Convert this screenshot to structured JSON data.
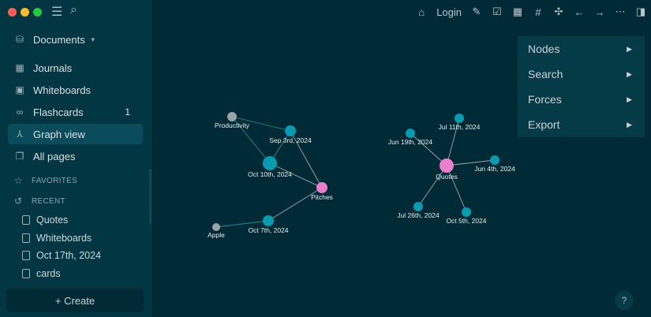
{
  "sidebar": {
    "workspace": "Documents",
    "nav": [
      {
        "label": "Journals",
        "icon": "calendar-icon"
      },
      {
        "label": "Whiteboards",
        "icon": "whiteboard-icon"
      },
      {
        "label": "Flashcards",
        "icon": "infinity-icon",
        "badge": "1"
      },
      {
        "label": "Graph view",
        "icon": "graph-icon",
        "active": true
      },
      {
        "label": "All pages",
        "icon": "pages-icon"
      }
    ],
    "favorites": "FAVORITES",
    "recent": "RECENT",
    "recent_items": [
      "Quotes",
      "Whiteboards",
      "Oct 17th, 2024",
      "cards"
    ],
    "create": "+ Create"
  },
  "toolbar": {
    "login": "Login"
  },
  "menu": [
    "Nodes",
    "Search",
    "Forces",
    "Export"
  ],
  "help": "?",
  "graph": {
    "nodes": [
      "Productivity",
      "Sep 3rd, 2024",
      "Oct 10th, 2024",
      "Pitches",
      "Oct 7th, 2024",
      "Apple",
      "Quotes",
      "Jun 19th, 2024",
      "Jul 11th, 2024",
      "Jun 4th, 2024",
      "Jul 26th, 2024",
      "Oct 5th, 2024"
    ],
    "edges": [
      [
        "Productivity",
        "Sep 3rd, 2024"
      ],
      [
        "Productivity",
        "Oct 10th, 2024"
      ],
      [
        "Sep 3rd, 2024",
        "Oct 10th, 2024"
      ],
      [
        "Sep 3rd, 2024",
        "Pitches"
      ],
      [
        "Oct 10th, 2024",
        "Pitches"
      ],
      [
        "Pitches",
        "Oct 7th, 2024"
      ],
      [
        "Oct 7th, 2024",
        "Apple"
      ],
      [
        "Quotes",
        "Jun 19th, 2024"
      ],
      [
        "Quotes",
        "Jul 11th, 2024"
      ],
      [
        "Quotes",
        "Jun 4th, 2024"
      ],
      [
        "Quotes",
        "Jul 26th, 2024"
      ],
      [
        "Quotes",
        "Oct 5th, 2024"
      ]
    ],
    "colors": {
      "page": "#0a9bb0",
      "tag": "#ec7fcb",
      "orphan": "#9aa3a5"
    }
  }
}
